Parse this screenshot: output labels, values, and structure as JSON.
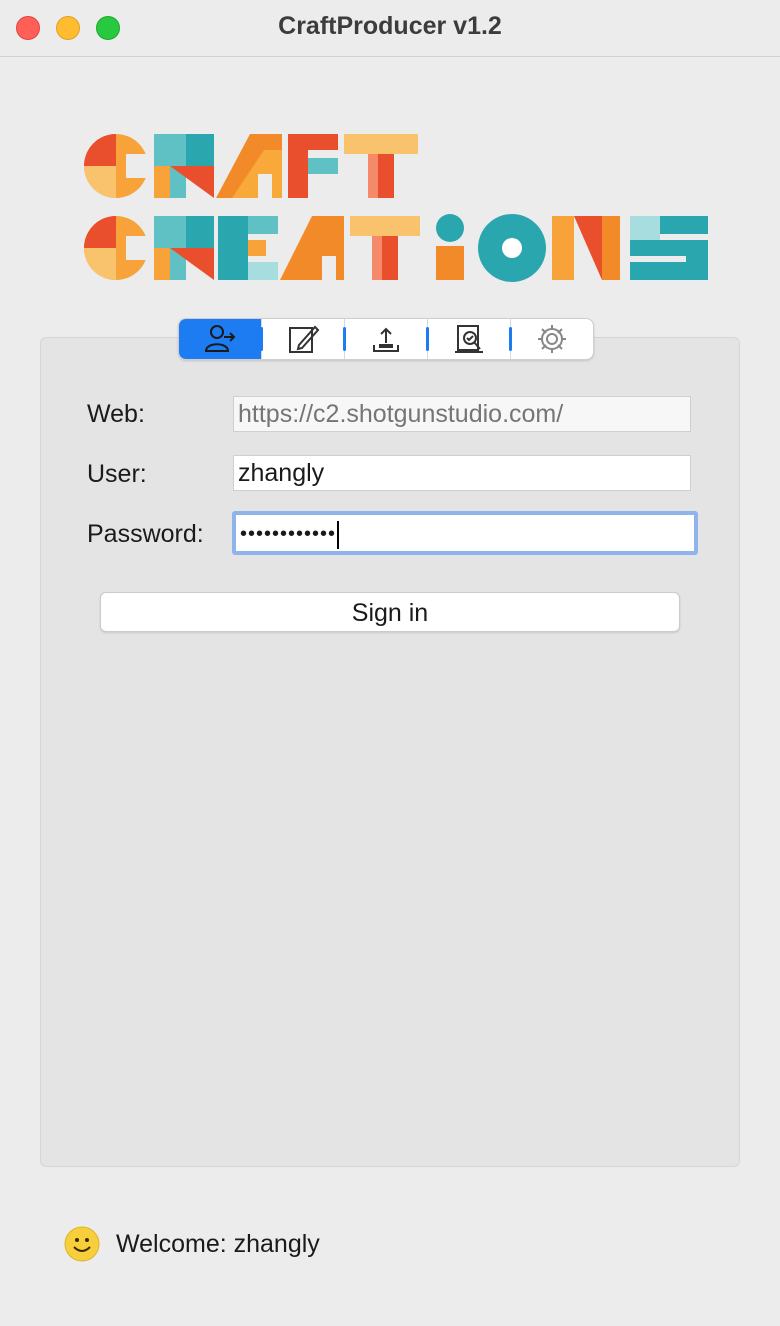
{
  "window": {
    "title": "CraftProducer v1.2"
  },
  "logo": {
    "line1": "CRAFT",
    "line2": "CREATIONS"
  },
  "tabs": [
    {
      "name": "login",
      "icon": "user-login-icon",
      "active": true
    },
    {
      "name": "edit",
      "icon": "edit-icon",
      "active": false
    },
    {
      "name": "upload",
      "icon": "upload-icon",
      "active": false
    },
    {
      "name": "review",
      "icon": "review-icon",
      "active": false
    },
    {
      "name": "settings",
      "icon": "gear-icon",
      "active": false
    }
  ],
  "form": {
    "web_label": "Web:",
    "web_placeholder": "https://c2.shotgunstudio.com/",
    "user_label": "User:",
    "user_value": "zhangly",
    "password_label": "Password:",
    "password_mask": "••••••••••••",
    "signin_label": "Sign in"
  },
  "status": {
    "text": "Welcome: zhangly",
    "icon": "smiley-icon"
  },
  "colors": {
    "accent": "#1e7cf2",
    "focus_ring": "#8fb4ec"
  }
}
